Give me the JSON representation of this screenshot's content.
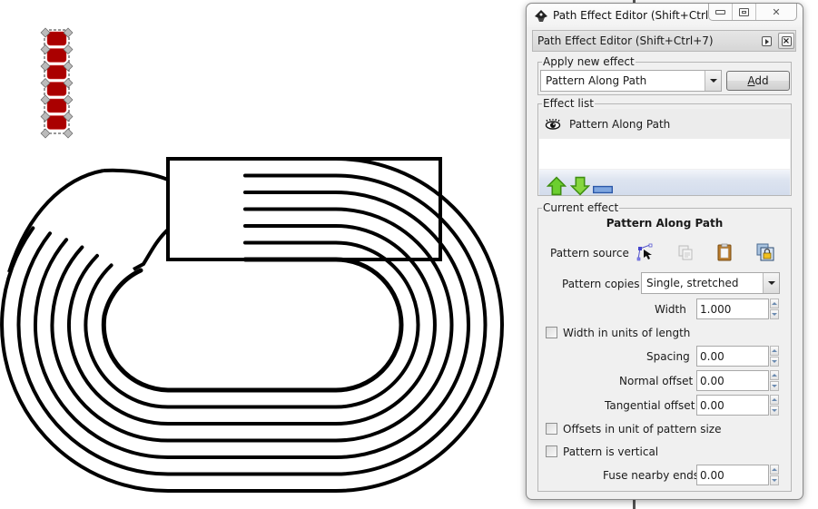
{
  "canvas": {
    "selected_object": "pattern-source-chain",
    "pattern_fill_color": "#aa0000",
    "stroke_color": "#000000",
    "pattern_links": 6
  },
  "window": {
    "title": "Path Effect Editor (Shift+Ctrl...",
    "minimize_glyph": "▭",
    "maximize_glyph": "□",
    "close_glyph": "✕"
  },
  "dock": {
    "title": "Path Effect Editor (Shift+Ctrl+7)"
  },
  "apply_new_effect": {
    "label": "Apply new effect",
    "selected": "Pattern Along Path",
    "add_button": "Add",
    "add_button_mnemonic": "A"
  },
  "effect_list": {
    "label": "Effect list",
    "items": [
      {
        "name": "Pattern Along Path",
        "visible": true
      }
    ],
    "toolbar": [
      "move-up",
      "move-down",
      "remove"
    ]
  },
  "current_effect": {
    "label": "Current effect",
    "title": "Pattern Along Path",
    "pattern_source_label": "Pattern source",
    "pattern_source_buttons": [
      "edit-on-canvas",
      "copy",
      "paste",
      "link-to-path"
    ],
    "pattern_copies_label": "Pattern copies",
    "pattern_copies_value": "Single, stretched",
    "width_label": "Width",
    "width_value": "1.000",
    "width_in_units_label": "Width in units of length",
    "width_in_units_checked": false,
    "spacing_label": "Spacing",
    "spacing_value": "0.00",
    "normal_offset_label": "Normal offset",
    "normal_offset_value": "0.00",
    "tangential_offset_label": "Tangential offset",
    "tangential_offset_value": "0.00",
    "offsets_in_pattern_size_label": "Offsets in unit of pattern size",
    "offsets_in_pattern_size_checked": false,
    "pattern_vertical_label": "Pattern is vertical",
    "pattern_vertical_checked": false,
    "fuse_nearby_ends_label": "Fuse nearby ends",
    "fuse_nearby_ends_value": "0.00"
  }
}
